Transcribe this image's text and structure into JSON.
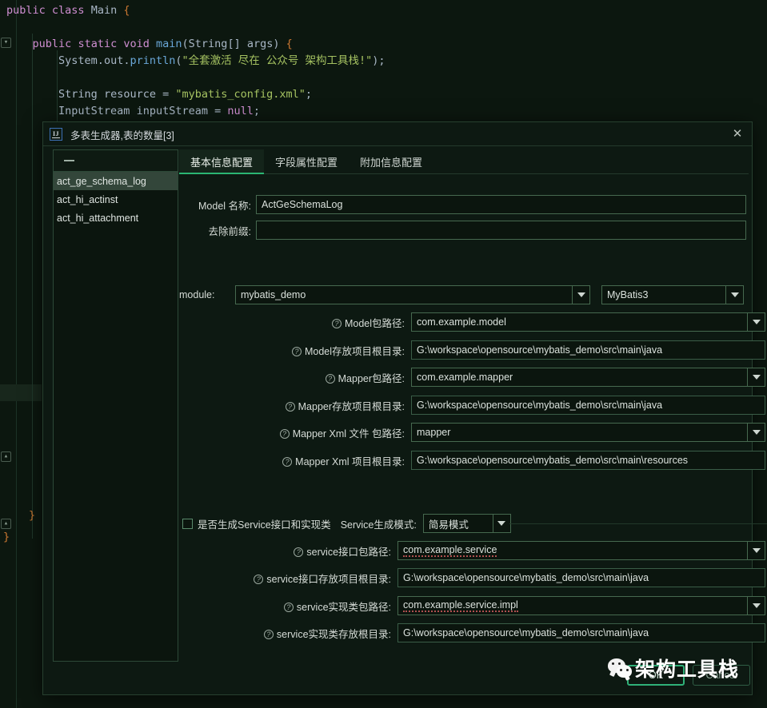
{
  "editor": {
    "lines": [
      "public class Main {",
      "",
      "    public static void main(String[] args) {",
      "        System.out.println(\"全套激活 尽在 公众号 架构工具栈!\");",
      "",
      "        String resource = \"mybatis_config.xml\";",
      "        InputStream inputStream = null;"
    ],
    "closing_braces": [
      "}",
      "}"
    ],
    "string_literal_1": "\"全套激活 尽在 公众号 架构工具栈!\"",
    "string_literal_2": "\"mybatis_config.xml\""
  },
  "dialog": {
    "icon_label": "IJ",
    "title": "多表生成器,表的数量[3]",
    "close_label": "✕",
    "table_list": {
      "header_icon": "minus-icon",
      "items": [
        {
          "label": "act_ge_schema_log",
          "selected": true
        },
        {
          "label": "act_hi_actinst",
          "selected": false
        },
        {
          "label": "act_hi_attachment",
          "selected": false
        }
      ]
    },
    "tabs": [
      {
        "label": "基本信息配置",
        "active": true
      },
      {
        "label": "字段属性配置",
        "active": false
      },
      {
        "label": "附加信息配置",
        "active": false
      }
    ],
    "fields": {
      "model_name_label": "Model 名称:",
      "model_name_value": "ActGeSchemaLog",
      "prefix_label": "去除前缀:",
      "prefix_value": "",
      "module_label": "module:",
      "module_value": "mybatis_demo",
      "framework_value": "MyBatis3"
    },
    "paths": [
      {
        "label": "Model包路径:",
        "value": "com.example.model",
        "help": true,
        "combo": true,
        "browse": true,
        "misspell": false
      },
      {
        "label": "Model存放项目根目录:",
        "value": "G:\\workspace\\opensource\\mybatis_demo\\src\\main\\java",
        "help": true,
        "combo": false,
        "browse": true,
        "misspell": false
      },
      {
        "label": "Mapper包路径:",
        "value": "com.example.mapper",
        "help": true,
        "combo": true,
        "browse": true,
        "misspell": false
      },
      {
        "label": "Mapper存放项目根目录:",
        "value": "G:\\workspace\\opensource\\mybatis_demo\\src\\main\\java",
        "help": true,
        "combo": false,
        "browse": true,
        "misspell": false
      },
      {
        "label": "Mapper Xml 文件 包路径:",
        "value": "mapper",
        "help": true,
        "combo": true,
        "browse": true,
        "misspell": false
      },
      {
        "label": "Mapper Xml 项目根目录:",
        "value": "G:\\workspace\\opensource\\mybatis_demo\\src\\main\\resources",
        "help": true,
        "combo": false,
        "browse": true,
        "misspell": false
      }
    ],
    "service": {
      "checkbox_label": "是否生成Service接口和实现类",
      "checkbox_checked": false,
      "mode_label": "Service生成模式:",
      "mode_value": "简易模式",
      "paths": [
        {
          "label": "service接口包路径:",
          "value": "com.example.service",
          "help": true,
          "combo": true,
          "browse": true,
          "misspell": true
        },
        {
          "label": "service接口存放项目根目录:",
          "value": "G:\\workspace\\opensource\\mybatis_demo\\src\\main\\java",
          "help": true,
          "combo": false,
          "browse": true,
          "misspell": false
        },
        {
          "label": "service实现类包路径:",
          "value": "com.example.service.impl",
          "help": true,
          "combo": true,
          "browse": true,
          "misspell": true
        },
        {
          "label": "service实现类存放根目录:",
          "value": "G:\\workspace\\opensource\\mybatis_demo\\src\\main\\java",
          "help": true,
          "combo": false,
          "browse": true,
          "misspell": false
        }
      ]
    },
    "buttons": {
      "ok": "OK",
      "cancel": "Cancel"
    }
  },
  "watermark": {
    "text": "架构工具栈",
    "icon": "wechat-icon"
  },
  "colors": {
    "accent_green": "#2fb178",
    "tab_underline": "#2bb673",
    "dialog_bg": "#0d1912",
    "editor_bg": "#0c170f",
    "selection": "#33463a"
  }
}
